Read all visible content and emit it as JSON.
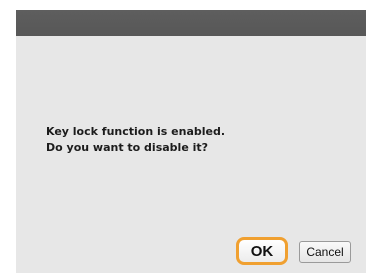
{
  "dialog": {
    "message_line1": "Key lock function is enabled.",
    "message_line2": "Do you want to disable it?",
    "ok_label": "OK",
    "cancel_label": "Cancel"
  },
  "colors": {
    "title_bar": "#5a5a5a",
    "dialog_bg": "#e7e7e7",
    "focus_ring": "#f0a030"
  }
}
